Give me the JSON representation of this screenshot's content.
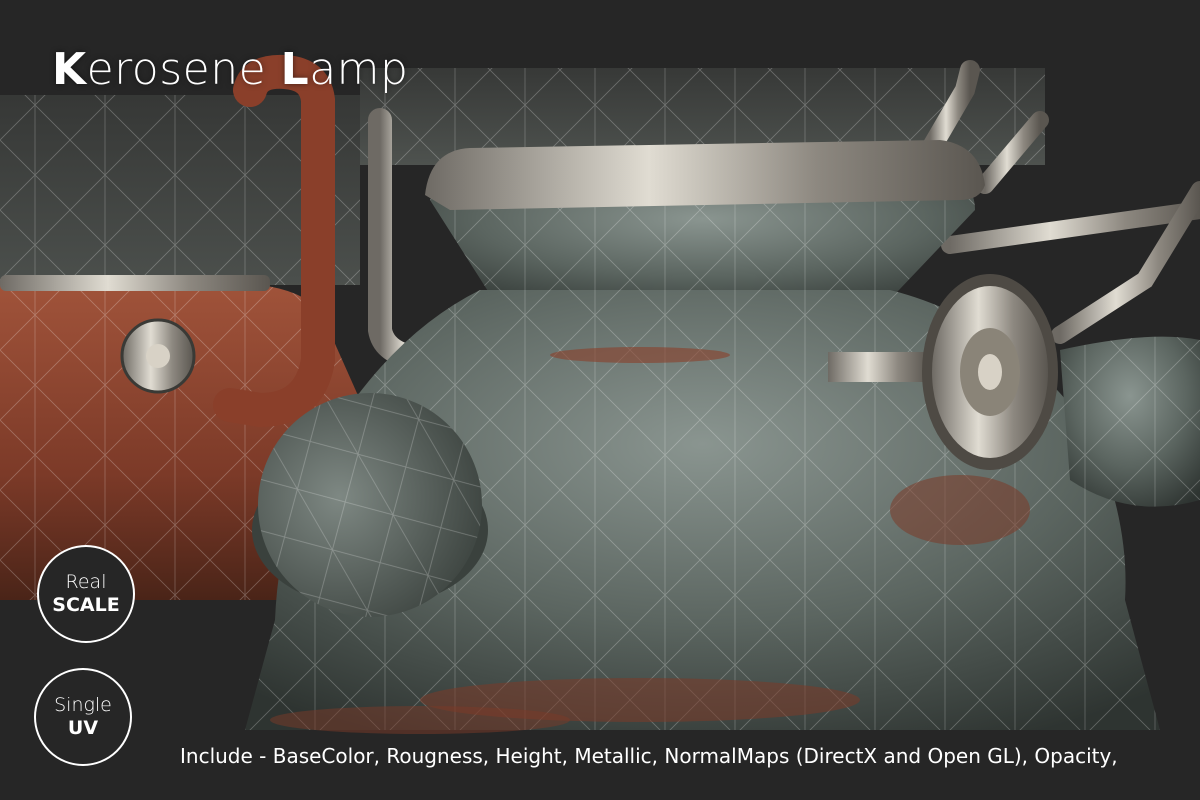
{
  "title": {
    "first_cap": "K",
    "first_rest": "erosene ",
    "second_cap": "L",
    "second_rest": "amp"
  },
  "badges": {
    "scale": {
      "top": "Real",
      "bottom": "SCALE"
    },
    "uv": {
      "top": "Single",
      "bottom": "UV"
    }
  },
  "caption": "Include - BaseColor, Rougness, Height, Metallic, NormalMaps (DirectX and Open GL), Opacity,",
  "colors": {
    "background": "#262626",
    "metal_gray": "#5c6660",
    "rust": "#8a3f2a",
    "chrome": "#b8b2a8",
    "text": "#ffffff"
  }
}
